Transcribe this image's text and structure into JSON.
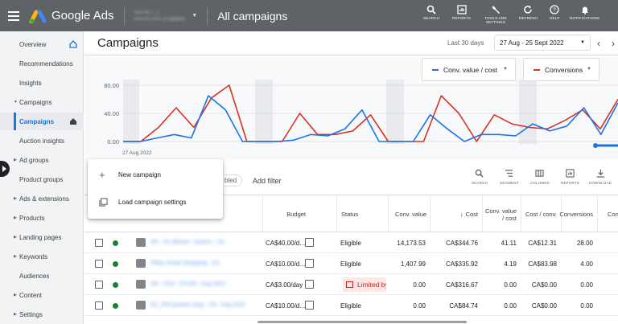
{
  "app": {
    "brand": "Google Ads",
    "page": "All campaigns",
    "account_name": "Soc MCT_1",
    "account_id": "xxx-xxx-xxxx (Engaged)"
  },
  "toolbar": [
    {
      "label": "SEARCH",
      "icon": "search-icon"
    },
    {
      "label": "REPORTS",
      "icon": "reports-icon"
    },
    {
      "label": "TOOLS AND SETTINGS",
      "icon": "wrench-icon"
    },
    {
      "label": "REFRESH",
      "icon": "refresh-icon"
    },
    {
      "label": "HELP",
      "icon": "help-icon"
    },
    {
      "label": "NOTIFICATIONS",
      "icon": "bell-icon"
    }
  ],
  "sidebar": {
    "items": [
      {
        "label": "Overview",
        "home": true
      },
      {
        "label": "Recommendations"
      },
      {
        "label": "Insights"
      },
      {
        "label": "Campaigns",
        "expanded": true
      },
      {
        "label": "Campaigns",
        "active": true,
        "home": true
      },
      {
        "label": "Auction insights"
      },
      {
        "label": "Ad groups",
        "collapsed": true
      },
      {
        "label": "Product groups"
      },
      {
        "label": "Ads & extensions",
        "collapsed": true
      },
      {
        "label": "Products",
        "collapsed": true
      },
      {
        "label": "Landing pages",
        "collapsed": true
      },
      {
        "label": "Keywords",
        "collapsed": true
      },
      {
        "label": "Audiences"
      },
      {
        "label": "Content",
        "collapsed": true
      },
      {
        "label": "Settings",
        "collapsed": true
      }
    ]
  },
  "header": {
    "title": "Campaigns",
    "range_label": "Last 30 days",
    "range_value": "27 Aug - 25 Sept 2022"
  },
  "metrics": [
    {
      "label": "Conv. value / cost",
      "color": "#1a73e8"
    },
    {
      "label": "Conversions",
      "color": "#d93025"
    }
  ],
  "chart_data": {
    "type": "line",
    "y_ticks": [
      "80.00",
      "40.00",
      "0.00"
    ],
    "ylim": [
      0,
      80
    ],
    "x_start_label": "27 Aug 2022",
    "series": [
      {
        "name": "Conversions",
        "color": "#d93025",
        "values": [
          0,
          0,
          20,
          48,
          20,
          62,
          80,
          0,
          0,
          0,
          40,
          10,
          10,
          15,
          38,
          0,
          0,
          0,
          65,
          40,
          0,
          38,
          25,
          20,
          18,
          30,
          45,
          18,
          60
        ]
      },
      {
        "name": "Conv. value / cost",
        "color": "#1a73e8",
        "values": [
          0,
          0,
          5,
          10,
          5,
          65,
          45,
          0,
          0,
          0,
          2,
          10,
          8,
          18,
          45,
          0,
          0,
          0,
          38,
          18,
          0,
          10,
          10,
          8,
          25,
          15,
          22,
          48,
          10,
          55
        ]
      }
    ]
  },
  "table_toolbar": {
    "chip_fragment": "bled",
    "add_filter": "Add filter",
    "tools": [
      {
        "label": "SEARCH",
        "icon": "search-icon"
      },
      {
        "label": "SEGMENT",
        "icon": "segment-icon"
      },
      {
        "label": "COLUMNS",
        "icon": "columns-icon"
      },
      {
        "label": "REPORTS",
        "icon": "reports-icon"
      },
      {
        "label": "DOWNLOAD",
        "icon": "download-icon"
      }
    ]
  },
  "popup": {
    "items": [
      {
        "label": "New campaign",
        "icon": "plus-icon"
      },
      {
        "label": "Load campaign settings",
        "icon": "copy-icon"
      }
    ]
  },
  "table": {
    "headers": {
      "budget": "Budget",
      "status": "Status",
      "conv_value": "Conv. value",
      "cost": "Cost",
      "conv_value_cost": "Conv. value / cost",
      "cost_conv": "Cost / conv.",
      "conversions": "Conversions",
      "conv_rate": "Conv"
    },
    "rows": [
      {
        "name": "SN - DL (Brand - Search - CA",
        "budget": "CA$40.00/d…",
        "status": "Eligible",
        "conv_value": "14,173.53",
        "cost": "CA$344.76",
        "conv_value_cost": "41.11",
        "cost_conv": "CA$12.31",
        "conversions": "28.00"
      },
      {
        "name": "PMax Smart Shopping - CA",
        "budget": "CA$10.00/d…",
        "status": "Eligible",
        "conv_value": "1,407.99",
        "cost": "CA$335.92",
        "conv_value_cost": "4.19",
        "cost_conv": "CA$83.98",
        "conversions": "4.00"
      },
      {
        "name": "SN - DSA - CA EN - Aug 2022",
        "budget": "CA$3.00/day",
        "status": "Limited by budget",
        "conv_value": "0.00",
        "cost": "CA$316.67",
        "conv_value_cost": "0.00",
        "cost_conv": "CA$0.00",
        "conversions": "0.00"
      },
      {
        "name": "SC_PM [brands only] - CA - Aug 2022",
        "budget": "CA$10.00/d…",
        "status": "Eligible",
        "conv_value": "0.00",
        "cost": "CA$84.74",
        "conv_value_cost": "0.00",
        "cost_conv": "CA$0.00",
        "conversions": "0.00"
      }
    ]
  }
}
